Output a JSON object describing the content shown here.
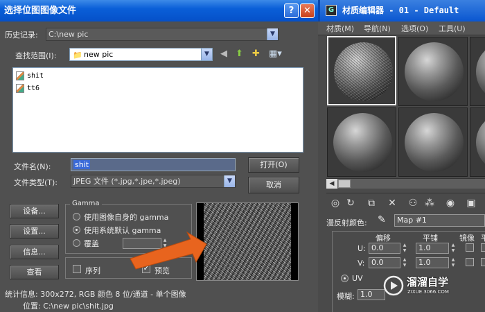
{
  "dialog": {
    "title": "选择位图图像文件",
    "help_label": "?",
    "close_label": "✕",
    "history_label": "历史记录:",
    "history_value": "C:\\new pic",
    "lookin_label": "查找范围(I):",
    "lookin_value": "new pic",
    "files": [
      {
        "name": "shit"
      },
      {
        "name": "tt6"
      }
    ],
    "filename_label": "文件名(N):",
    "filename_value": "shit",
    "filetype_label": "文件类型(T):",
    "filetype_value": "JPEG 文件 (*.jpg,*.jpe,*.jpeg)",
    "open_button": "打开(O)",
    "cancel_button": "取消",
    "setup_button": "设备...",
    "settings_button": "设置...",
    "info_button": "信息...",
    "view_button": "查看",
    "gamma": {
      "legend": "Gamma",
      "option_own": "使用图像自身的 gamma",
      "option_system": "使用系统默认 gamma",
      "option_override": "覆盖",
      "selected": "system"
    },
    "sequence_label": "序列",
    "sequence_checked": false,
    "preview_label": "预览",
    "preview_checked": true,
    "stats_text": "统计信息: 300x272, RGB 颜色 8 位/通道 - 单个图像",
    "location_text": "位置: C:\\new pic\\shit.jpg"
  },
  "material_editor": {
    "icon_label": "G",
    "title": "材质编辑器 - 01 - Default",
    "menu": [
      "材质(M)",
      "导航(N)",
      "选项(O)",
      "工具(U)"
    ],
    "diffuse_label": "漫反射颜色:",
    "map_name": "Map #1",
    "coords": {
      "offset_header": "偏移",
      "tiling_header": "平铺",
      "mirror_header": "镜像",
      "extra_header": "平",
      "u_label": "U:",
      "v_label": "V:",
      "u_offset": "0.0",
      "v_offset": "0.0",
      "u_tiling": "1.0",
      "v_tiling": "1.0",
      "uv_label": "UV",
      "blur_label": "模糊:",
      "blur_value": "1.0"
    }
  },
  "watermark": {
    "brand": "溜溜自学",
    "url": "ZIXUE.3066.COM"
  },
  "colors": {
    "titlebar_blue": "#0a5fd8",
    "panel_gray": "#505050",
    "arrow_orange": "#e8641e"
  }
}
